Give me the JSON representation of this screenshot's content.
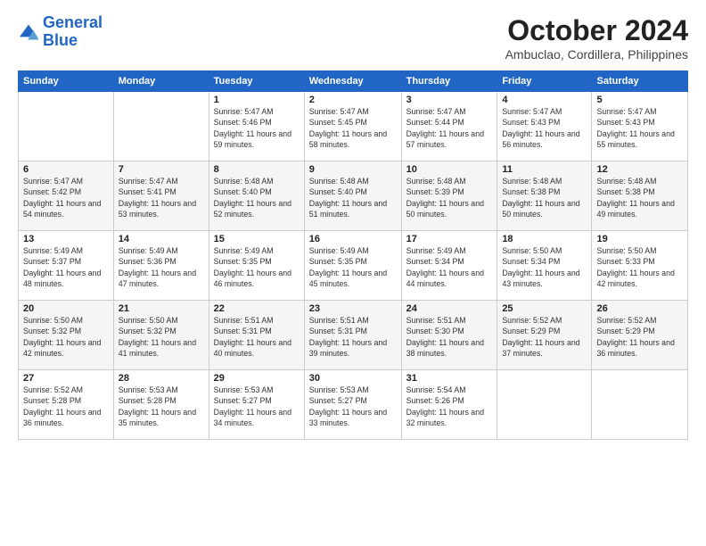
{
  "logo": {
    "line1": "General",
    "line2": "Blue"
  },
  "title": "October 2024",
  "location": "Ambuclao, Cordillera, Philippines",
  "weekdays": [
    "Sunday",
    "Monday",
    "Tuesday",
    "Wednesday",
    "Thursday",
    "Friday",
    "Saturday"
  ],
  "weeks": [
    [
      null,
      null,
      {
        "day": 1,
        "sunrise": "5:47 AM",
        "sunset": "5:46 PM",
        "daylight": "11 hours and 59 minutes."
      },
      {
        "day": 2,
        "sunrise": "5:47 AM",
        "sunset": "5:45 PM",
        "daylight": "11 hours and 58 minutes."
      },
      {
        "day": 3,
        "sunrise": "5:47 AM",
        "sunset": "5:44 PM",
        "daylight": "11 hours and 57 minutes."
      },
      {
        "day": 4,
        "sunrise": "5:47 AM",
        "sunset": "5:43 PM",
        "daylight": "11 hours and 56 minutes."
      },
      {
        "day": 5,
        "sunrise": "5:47 AM",
        "sunset": "5:43 PM",
        "daylight": "11 hours and 55 minutes."
      }
    ],
    [
      {
        "day": 6,
        "sunrise": "5:47 AM",
        "sunset": "5:42 PM",
        "daylight": "11 hours and 54 minutes."
      },
      {
        "day": 7,
        "sunrise": "5:47 AM",
        "sunset": "5:41 PM",
        "daylight": "11 hours and 53 minutes."
      },
      {
        "day": 8,
        "sunrise": "5:48 AM",
        "sunset": "5:40 PM",
        "daylight": "11 hours and 52 minutes."
      },
      {
        "day": 9,
        "sunrise": "5:48 AM",
        "sunset": "5:40 PM",
        "daylight": "11 hours and 51 minutes."
      },
      {
        "day": 10,
        "sunrise": "5:48 AM",
        "sunset": "5:39 PM",
        "daylight": "11 hours and 50 minutes."
      },
      {
        "day": 11,
        "sunrise": "5:48 AM",
        "sunset": "5:38 PM",
        "daylight": "11 hours and 50 minutes."
      },
      {
        "day": 12,
        "sunrise": "5:48 AM",
        "sunset": "5:38 PM",
        "daylight": "11 hours and 49 minutes."
      }
    ],
    [
      {
        "day": 13,
        "sunrise": "5:49 AM",
        "sunset": "5:37 PM",
        "daylight": "11 hours and 48 minutes."
      },
      {
        "day": 14,
        "sunrise": "5:49 AM",
        "sunset": "5:36 PM",
        "daylight": "11 hours and 47 minutes."
      },
      {
        "day": 15,
        "sunrise": "5:49 AM",
        "sunset": "5:35 PM",
        "daylight": "11 hours and 46 minutes."
      },
      {
        "day": 16,
        "sunrise": "5:49 AM",
        "sunset": "5:35 PM",
        "daylight": "11 hours and 45 minutes."
      },
      {
        "day": 17,
        "sunrise": "5:49 AM",
        "sunset": "5:34 PM",
        "daylight": "11 hours and 44 minutes."
      },
      {
        "day": 18,
        "sunrise": "5:50 AM",
        "sunset": "5:34 PM",
        "daylight": "11 hours and 43 minutes."
      },
      {
        "day": 19,
        "sunrise": "5:50 AM",
        "sunset": "5:33 PM",
        "daylight": "11 hours and 42 minutes."
      }
    ],
    [
      {
        "day": 20,
        "sunrise": "5:50 AM",
        "sunset": "5:32 PM",
        "daylight": "11 hours and 42 minutes."
      },
      {
        "day": 21,
        "sunrise": "5:50 AM",
        "sunset": "5:32 PM",
        "daylight": "11 hours and 41 minutes."
      },
      {
        "day": 22,
        "sunrise": "5:51 AM",
        "sunset": "5:31 PM",
        "daylight": "11 hours and 40 minutes."
      },
      {
        "day": 23,
        "sunrise": "5:51 AM",
        "sunset": "5:31 PM",
        "daylight": "11 hours and 39 minutes."
      },
      {
        "day": 24,
        "sunrise": "5:51 AM",
        "sunset": "5:30 PM",
        "daylight": "11 hours and 38 minutes."
      },
      {
        "day": 25,
        "sunrise": "5:52 AM",
        "sunset": "5:29 PM",
        "daylight": "11 hours and 37 minutes."
      },
      {
        "day": 26,
        "sunrise": "5:52 AM",
        "sunset": "5:29 PM",
        "daylight": "11 hours and 36 minutes."
      }
    ],
    [
      {
        "day": 27,
        "sunrise": "5:52 AM",
        "sunset": "5:28 PM",
        "daylight": "11 hours and 36 minutes."
      },
      {
        "day": 28,
        "sunrise": "5:53 AM",
        "sunset": "5:28 PM",
        "daylight": "11 hours and 35 minutes."
      },
      {
        "day": 29,
        "sunrise": "5:53 AM",
        "sunset": "5:27 PM",
        "daylight": "11 hours and 34 minutes."
      },
      {
        "day": 30,
        "sunrise": "5:53 AM",
        "sunset": "5:27 PM",
        "daylight": "11 hours and 33 minutes."
      },
      {
        "day": 31,
        "sunrise": "5:54 AM",
        "sunset": "5:26 PM",
        "daylight": "11 hours and 32 minutes."
      },
      null,
      null
    ]
  ]
}
